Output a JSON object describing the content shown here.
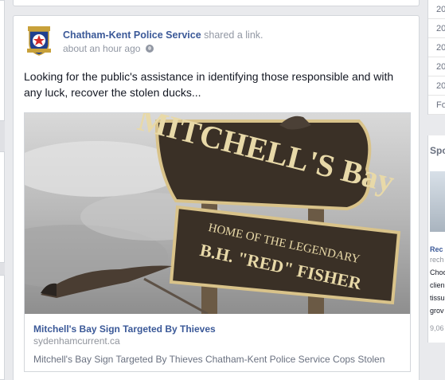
{
  "post": {
    "actor": "Chatham-Kent Police Service",
    "action": " shared a link.",
    "timestamp": "about an hour ago",
    "message": "Looking for the public's assistance in identifying those responsible and with any luck, recover the stolen ducks...",
    "link": {
      "title": "Mitchell's Bay Sign Targeted By Thieves",
      "domain": "sydenhamcurrent.ca",
      "description": "Mitchell's Bay Sign Targeted By Thieves Chatham-Kent Police Service Cops Stolen",
      "image_sign_main": "MITCHELL'S Bay",
      "image_sign_sub": "HOME OF THE LEGENDARY",
      "image_sign_name": "B.H. \"RED\" FISHER"
    }
  },
  "right_sidebar": {
    "years": [
      "20",
      "20",
      "20",
      "20",
      "20",
      "Fo"
    ],
    "sponsored_label": "Spo",
    "ad": {
      "title": "Rec",
      "subtitle": "rech",
      "lines": [
        "Choo",
        "clien",
        "tissu",
        "grov"
      ],
      "count": "9,06"
    }
  },
  "colors": {
    "link_blue": "#3b5998",
    "meta_gray": "#9197a3",
    "background": "#e9eaed"
  }
}
